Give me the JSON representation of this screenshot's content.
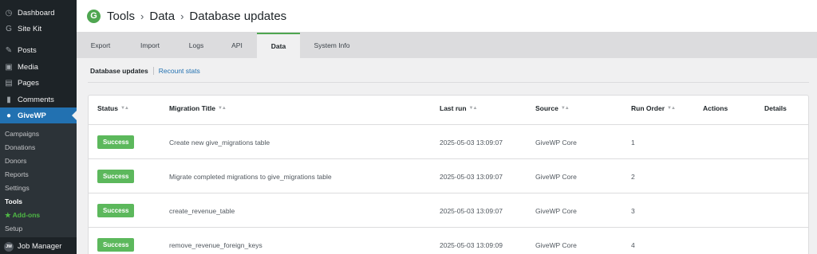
{
  "sidebar": {
    "top_items": [
      {
        "label": "Dashboard",
        "icon": "dashboard-icon",
        "glyph": "◷"
      },
      {
        "label": "Site Kit",
        "icon": "sitekit-icon",
        "glyph": "G"
      },
      {
        "label": "Posts",
        "icon": "pin-icon",
        "glyph": "✎"
      },
      {
        "label": "Media",
        "icon": "media-icon",
        "glyph": "▣"
      },
      {
        "label": "Pages",
        "icon": "pages-icon",
        "glyph": "▤"
      },
      {
        "label": "Comments",
        "icon": "comments-icon",
        "glyph": "▮"
      },
      {
        "label": "GiveWP",
        "icon": "givewp-icon",
        "glyph": "●"
      }
    ],
    "submenu": [
      {
        "label": "Campaigns"
      },
      {
        "label": "Donations"
      },
      {
        "label": "Donors"
      },
      {
        "label": "Reports"
      },
      {
        "label": "Settings"
      },
      {
        "label": "Tools"
      },
      {
        "label": "★ Add-ons"
      },
      {
        "label": "Setup"
      }
    ],
    "job_manager": {
      "label": "Job Manager",
      "badge": "JM"
    }
  },
  "header": {
    "logo_letter": "G",
    "crumbs": [
      "Tools",
      "Data",
      "Database updates"
    ],
    "separator": "›"
  },
  "tabs": [
    "Export",
    "Import",
    "Logs",
    "API",
    "Data",
    "System Info"
  ],
  "subnav": {
    "current": "Database updates",
    "link": "Recount stats"
  },
  "table": {
    "columns": [
      "Status",
      "Migration Title",
      "Last run",
      "Source",
      "Run Order",
      "Actions",
      "Details"
    ],
    "sort_glyph": "▼▲",
    "rows": [
      {
        "status": "Success",
        "title": "Create new give_migrations table",
        "last_run": "2025-05-03 13:09:07",
        "source": "GiveWP Core",
        "order": "1"
      },
      {
        "status": "Success",
        "title": "Migrate completed migrations to give_migrations table",
        "last_run": "2025-05-03 13:09:07",
        "source": "GiveWP Core",
        "order": "2"
      },
      {
        "status": "Success",
        "title": "create_revenue_table",
        "last_run": "2025-05-03 13:09:07",
        "source": "GiveWP Core",
        "order": "3"
      },
      {
        "status": "Success",
        "title": "remove_revenue_foreign_keys",
        "last_run": "2025-05-03 13:09:09",
        "source": "GiveWP Core",
        "order": "4"
      }
    ]
  },
  "colors": {
    "sidebar_bg": "#1d2327",
    "active_blue": "#2271b1",
    "success_green": "#5cb85c",
    "brand_green": "#4fa651",
    "addons_green": "#4fb845"
  }
}
